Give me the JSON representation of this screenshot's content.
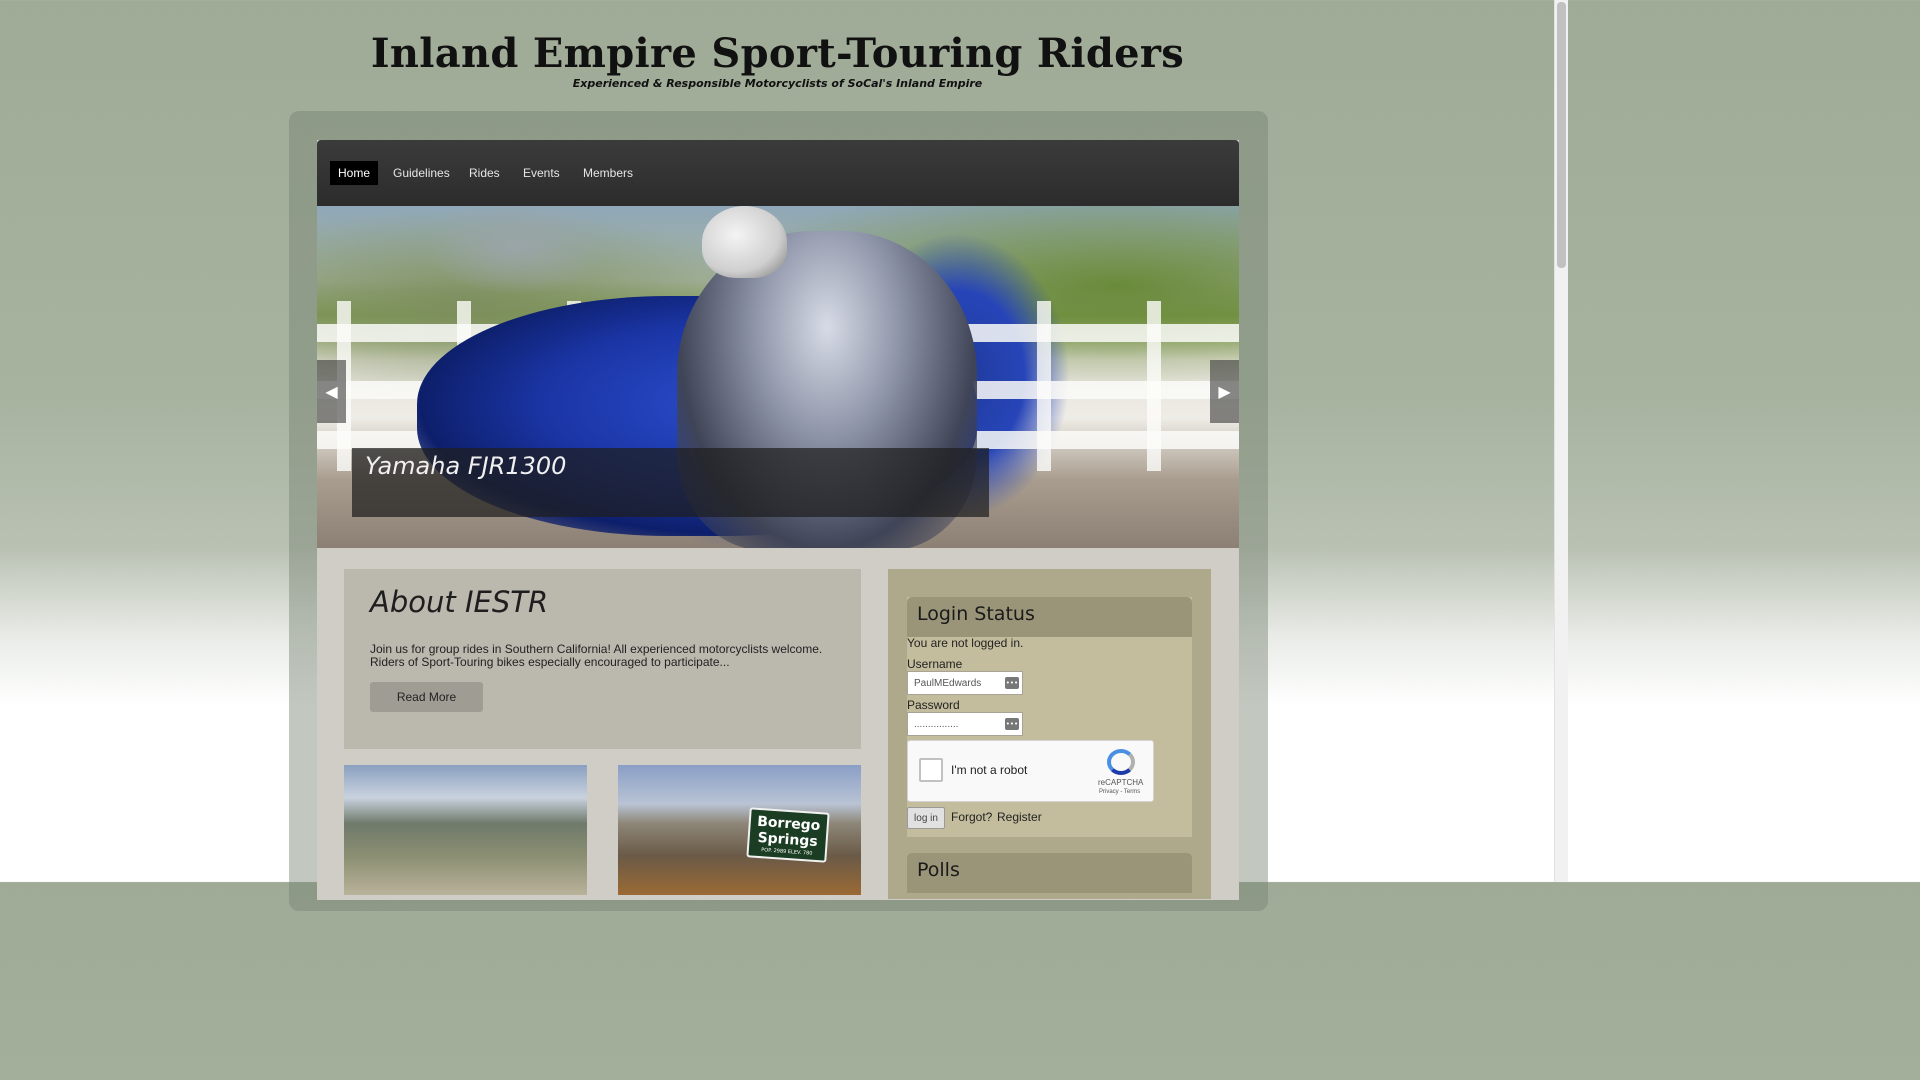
{
  "site": {
    "title": "Inland Empire Sport-Touring Riders",
    "tagline": "Experienced & Responsible Motorcyclists of SoCal's Inland Empire"
  },
  "nav": {
    "items": [
      {
        "label": "Home",
        "active": true
      },
      {
        "label": "Guidelines",
        "active": false
      },
      {
        "label": "Rides",
        "active": false
      },
      {
        "label": "Events",
        "active": false
      },
      {
        "label": "Members",
        "active": false
      }
    ]
  },
  "slider": {
    "caption": "Yamaha FJR1300",
    "prev_icon": "◀",
    "next_icon": "▶"
  },
  "about": {
    "title": "About IESTR",
    "text_line1": "Join us for group rides in Southern California! All experienced motorcyclists welcome.",
    "text_line2": "Riders of Sport-Touring bikes especially encouraged to participate...",
    "button_label": "Read More"
  },
  "thumbnails": {
    "sign_line1": "Borrego",
    "sign_line2": "Springs",
    "sign_small": "POP. 2989   ELEV. 780"
  },
  "login": {
    "title": "Login Status",
    "status": "You are not logged in.",
    "username_label": "Username",
    "username_value": "PaulMEdwards",
    "password_label": "Password",
    "password_value": "................",
    "recaptcha_label": "I'm not a robot",
    "recaptcha_brand": "reCAPTCHA",
    "recaptcha_links": "Privacy - Terms",
    "login_button": "log in",
    "forgot_link": "Forgot?",
    "register_link": "Register"
  },
  "polls": {
    "title": "Polls"
  },
  "colors": {
    "background": "#a7b39f",
    "nav_bg": "#333333",
    "panel_header": "#9a9578",
    "sidebar": "#aea98a"
  }
}
